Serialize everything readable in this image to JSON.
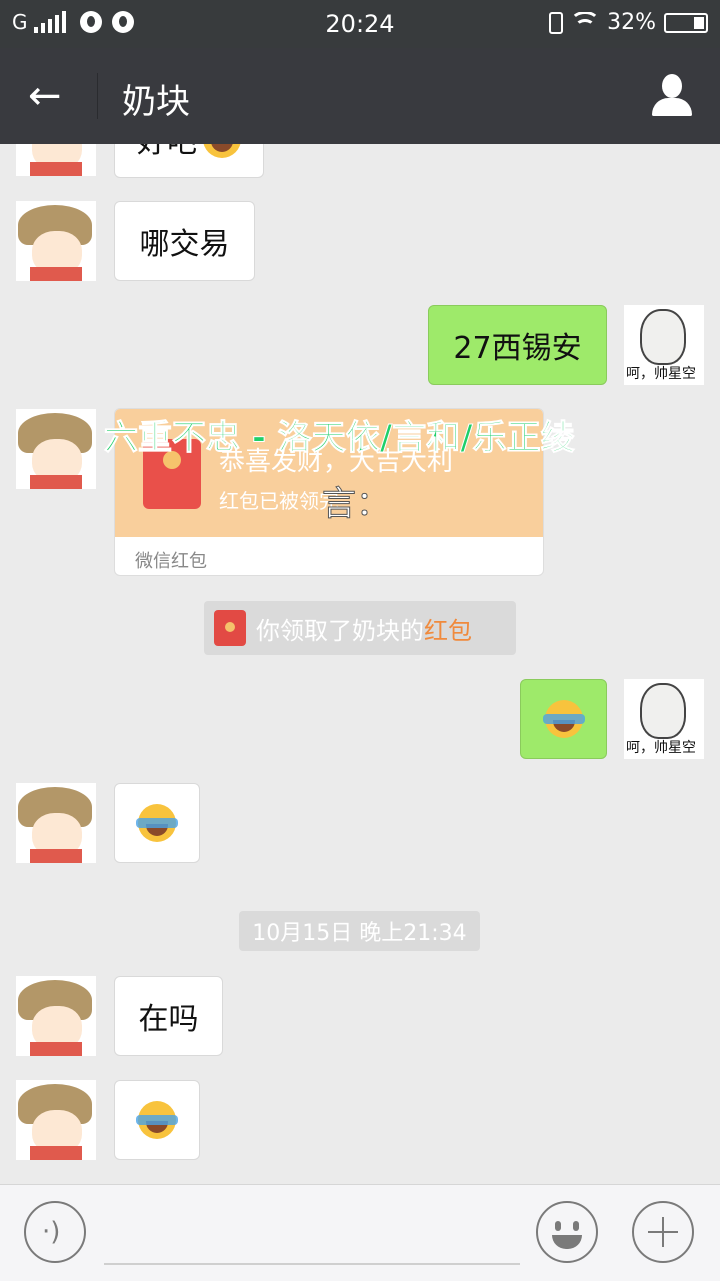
{
  "status_bar": {
    "network": "G",
    "time": "20:24",
    "battery": "32%",
    "icons": [
      "signal-icon",
      "qq-icon",
      "qq-icon",
      "vibrate-icon",
      "wifi-icon",
      "battery-icon"
    ]
  },
  "header": {
    "title": "奶块",
    "back_icon": "arrow-left-icon",
    "profile_icon": "person-icon"
  },
  "messages": [
    {
      "side": "in",
      "text": "好吧",
      "emoji": "facepalm-laugh"
    },
    {
      "side": "in",
      "text": "哪交易"
    },
    {
      "side": "out",
      "text": "27西锡安"
    },
    {
      "side": "in",
      "type": "red_packet",
      "title": "恭喜发财，大吉大利",
      "subtitle": "红包已被领完",
      "footer": "微信红包"
    },
    {
      "side": "system",
      "type": "red_packet_notice",
      "text": "你领取了奶块的",
      "highlight": "红包"
    },
    {
      "side": "out",
      "emoji": "facepalm-laugh"
    },
    {
      "side": "in",
      "emoji": "facepalm-laugh"
    },
    {
      "side": "system",
      "type": "timestamp",
      "text": "10月15日 晚上21:34"
    },
    {
      "side": "in",
      "text": "在吗"
    },
    {
      "side": "in",
      "emoji": "facepalm-laugh"
    }
  ],
  "overlay": {
    "line1": "六重不忠 - 洛天依/言和/乐正绫",
    "line2": "言："
  },
  "my_avatar": {
    "caption": "呵，帅星空"
  },
  "input_bar": {
    "voice_icon": "voice-icon",
    "emoji_icon": "smile-icon",
    "plus_icon": "plus-icon"
  },
  "colors": {
    "header_bg": "#393a3f",
    "status_bg": "#383b3d",
    "chat_bg": "#ebebeb",
    "out_bubble": "#9eea6a",
    "in_bubble": "#ffffff",
    "red_packet": "#f9cf9c",
    "highlight": "#f08a3c",
    "overlay_text": "#1fcf6a"
  }
}
